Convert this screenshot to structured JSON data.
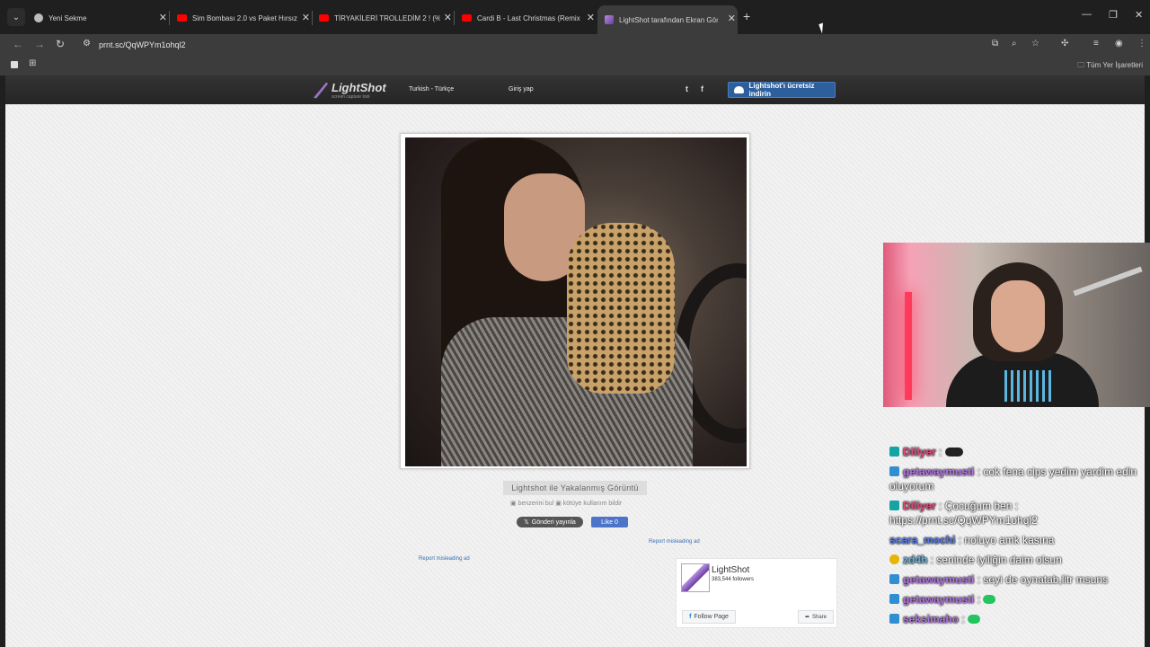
{
  "browser": {
    "tabs": [
      {
        "label": "Yeni Sekme",
        "favicon": "globe-icon"
      },
      {
        "label": "Sim Bombası 2.0 vs Paket Hırsız",
        "favicon": "youtube-icon"
      },
      {
        "label": "TİRYAKİLERİ TROLLEDİM 2 ! (%1",
        "favicon": "youtube-icon"
      },
      {
        "label": "Cardi B - Last Christmas (Remix",
        "favicon": "youtube-icon"
      },
      {
        "label": "LightShot tarafından Ekran Görü",
        "favicon": "lightshot-icon"
      }
    ],
    "url": "prnt.sc/QqWPYm1ohql2",
    "bookmarks_all": "Tüm Yer İşaretleri"
  },
  "lightshot": {
    "logo": "LightShot",
    "logo_sub": "screen capture tool",
    "language": "Turkish - Türkçe",
    "login": "Giriş yap",
    "twitter": "t",
    "facebook": "f",
    "download": "Lightshot'ı ücretsiz indirin",
    "caption": "Lightshot ile Yakalanmış Görüntü",
    "find_similar": "benzerini bul",
    "report_abuse": "kötüye kullanım bildir",
    "tweet": "Gönderi yayınla",
    "like": "Like 0",
    "report_ad": "Report misleading ad",
    "fb_name": "LightShot",
    "fb_followers": "383,544 followers",
    "fb_follow": "Follow Page",
    "fb_share": "Share"
  },
  "chat": [
    {
      "user": "Diliyer",
      "color": "#e04a7a",
      "badge": "twitch",
      "text": " : "
    },
    {
      "user": "getawaymusti",
      "color": "#b276e0",
      "badge": "kick",
      "text": " : cok fena cips yedim yardim edin oluyorum"
    },
    {
      "user": "Diliyer",
      "color": "#e04a7a",
      "badge": "twitch",
      "text": " : Çocuğum ben : https://prnt.sc/QqWPYm1ohql2"
    },
    {
      "user": "scara_mochi",
      "color": "#5a7ae8",
      "badge": "none",
      "text": " : noluyo amk kasına"
    },
    {
      "user": "zd4h",
      "color": "#6ab0d8",
      "badge": "yellow",
      "text": " : seninde iyiliğin daim olsun"
    },
    {
      "user": "getawaymusti",
      "color": "#b276e0",
      "badge": "kick",
      "text": " : seyi de oynatab,litr msuns"
    },
    {
      "user": "getawaymusti",
      "color": "#b276e0",
      "badge": "kick",
      "text": " : "
    },
    {
      "user": "seksimaho",
      "color": "#b276e0",
      "badge": "kick",
      "text": " : "
    }
  ],
  "colors": {
    "chrome_bg": "#1f1f1f",
    "toolbar": "#3c3c3c",
    "download_button": "#2d5f9c",
    "page_bg": "#ececec"
  }
}
